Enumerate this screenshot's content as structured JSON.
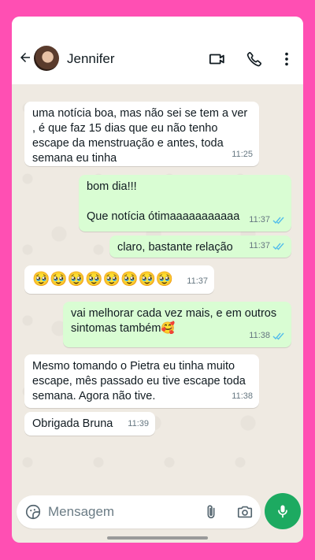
{
  "header": {
    "contact_name": "Jennifer",
    "back_icon": "arrow-left-icon",
    "video_icon": "video-call-icon",
    "call_icon": "phone-icon",
    "menu_icon": "more-vertical-icon"
  },
  "messages": [
    {
      "direction": "incoming",
      "text": "uma notícia boa, mas não sei se tem a ver , é que faz 15 dias que eu não tenho escape da menstruação e antes, toda semana eu tinha",
      "time": "11:25"
    },
    {
      "direction": "outgoing",
      "text": "bom dia!!!\n\nQue notícia ótimaaaaaaaaaaa",
      "time": "11:37",
      "read": true
    },
    {
      "direction": "outgoing",
      "text": "claro, bastante relação",
      "time": "11:37",
      "read": true
    },
    {
      "direction": "incoming",
      "text": "🥹🥹🥹🥹🥹🥹🥹🥹",
      "time": "11:37"
    },
    {
      "direction": "outgoing",
      "text": "vai melhorar cada vez mais, e em outros sintomas também🥰",
      "time": "11:38",
      "read": true
    },
    {
      "direction": "incoming",
      "text": "Mesmo tomando o Pietra eu tinha muito escape, mês passado eu tive escape toda semana. Agora não tive.",
      "time": "11:38"
    },
    {
      "direction": "incoming",
      "text": "Obrigada Bruna",
      "time": "11:39"
    }
  ],
  "composer": {
    "placeholder": "Mensagem",
    "value": ""
  },
  "colors": {
    "frame": "#ff4fb3",
    "chat_bg": "#efeae2",
    "outgoing_bubble": "#d9fdd3",
    "incoming_bubble": "#ffffff",
    "read_ticks": "#53bdeb",
    "mic_button": "#1daa61"
  }
}
